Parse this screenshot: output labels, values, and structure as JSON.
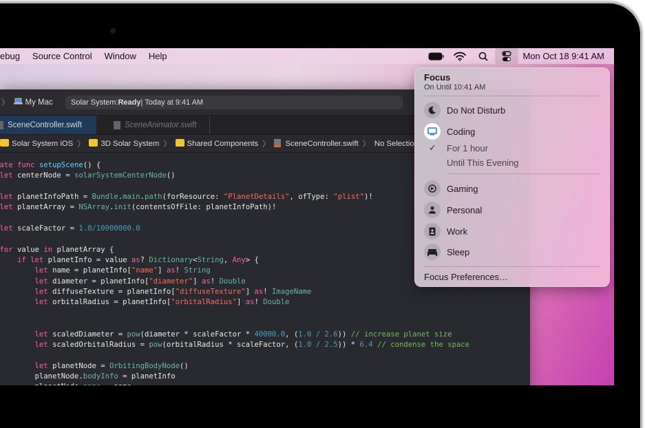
{
  "menubar": {
    "menus": [
      "ebug",
      "Source Control",
      "Window",
      "Help"
    ],
    "clock": "Mon Oct 18  9:41 AM",
    "status_icons": [
      "battery-icon",
      "wifi-icon",
      "search-icon",
      "control-center-icon"
    ]
  },
  "xcode": {
    "scheme": {
      "target": "My Mac"
    },
    "activity": {
      "project": "Solar System: ",
      "state": "Ready",
      "time": " | Today at 9:41 AM"
    },
    "tabs": [
      {
        "label": "SceneController.swift",
        "active": true
      },
      {
        "label": "SceneAnimator.swift",
        "active": false
      }
    ],
    "jumpbar": [
      "Solar System iOS",
      "3D Solar System",
      "Shared Components",
      "SceneController.swift",
      "No Selection"
    ],
    "code": [
      [
        [
          "private ",
          "kw"
        ],
        [
          "func ",
          "kw"
        ],
        [
          "setupScene",
          "ty"
        ],
        [
          "() {",
          "pl"
        ]
      ],
      [
        [
          "    let ",
          "kw"
        ],
        [
          "centerNode = ",
          "pl"
        ],
        [
          "solarSystemCenterNode",
          "fn"
        ],
        [
          "()",
          "pl"
        ]
      ],
      [],
      [
        [
          "    let ",
          "kw"
        ],
        [
          "planetInfoPath = ",
          "pl"
        ],
        [
          "Bundle",
          "fn"
        ],
        [
          ".",
          "pl"
        ],
        [
          "main",
          "fn"
        ],
        [
          ".",
          "pl"
        ],
        [
          "path",
          "fn"
        ],
        [
          "(forResource: ",
          "pl"
        ],
        [
          "\"PlanetDetails\"",
          "str"
        ],
        [
          ", ofType: ",
          "pl"
        ],
        [
          "\"plist\"",
          "str"
        ],
        [
          ")!",
          "pl"
        ]
      ],
      [
        [
          "    let ",
          "kw"
        ],
        [
          "planetArray = ",
          "pl"
        ],
        [
          "NSArray",
          "fn"
        ],
        [
          ".",
          "pl"
        ],
        [
          "init",
          "fn"
        ],
        [
          "(contentsOfFile: planetInfoPath)!",
          "pl"
        ]
      ],
      [],
      [
        [
          "    let ",
          "kw"
        ],
        [
          "scaleFactor = ",
          "pl"
        ],
        [
          "1.0/10000000.0",
          "num"
        ]
      ],
      [],
      [
        [
          "    for ",
          "kw"
        ],
        [
          "value ",
          "pl"
        ],
        [
          "in ",
          "kw"
        ],
        [
          "planetArray {",
          "pl"
        ]
      ],
      [
        [
          "        if let ",
          "kw"
        ],
        [
          "planetInfo = value ",
          "pl"
        ],
        [
          "as",
          "kw"
        ],
        [
          "? ",
          "pl"
        ],
        [
          "Dictionary",
          "fn"
        ],
        [
          "<",
          "pl"
        ],
        [
          "String",
          "fn"
        ],
        [
          ", ",
          "pl"
        ],
        [
          "Any",
          "kw"
        ],
        [
          "> {",
          "pl"
        ]
      ],
      [
        [
          "            let ",
          "kw"
        ],
        [
          "name = planetInfo[",
          "pl"
        ],
        [
          "\"name\"",
          "str"
        ],
        [
          "] ",
          "pl"
        ],
        [
          "as",
          "kw"
        ],
        [
          "! ",
          "pl"
        ],
        [
          "String",
          "fn"
        ]
      ],
      [
        [
          "            let ",
          "kw"
        ],
        [
          "diameter = planetInfo[",
          "pl"
        ],
        [
          "\"diameter\"",
          "str"
        ],
        [
          "] ",
          "pl"
        ],
        [
          "as",
          "kw"
        ],
        [
          "! ",
          "pl"
        ],
        [
          "Double",
          "fn"
        ]
      ],
      [
        [
          "            let ",
          "kw"
        ],
        [
          "diffuseTexture = planetInfo[",
          "pl"
        ],
        [
          "\"diffuseTexture\"",
          "str"
        ],
        [
          "] ",
          "pl"
        ],
        [
          "as",
          "kw"
        ],
        [
          "! ",
          "pl"
        ],
        [
          "ImageName",
          "fn"
        ]
      ],
      [
        [
          "            let ",
          "kw"
        ],
        [
          "orbitalRadius = planetInfo[",
          "pl"
        ],
        [
          "\"orbitalRadius\"",
          "str"
        ],
        [
          "] ",
          "pl"
        ],
        [
          "as",
          "kw"
        ],
        [
          "! ",
          "pl"
        ],
        [
          "Double",
          "fn"
        ]
      ],
      [],
      [],
      [
        [
          "            let ",
          "kw"
        ],
        [
          "scaledDiameter = ",
          "pl"
        ],
        [
          "pow",
          "fn"
        ],
        [
          "(diameter * scaleFactor * ",
          "pl"
        ],
        [
          "40000.0",
          "num"
        ],
        [
          ", (",
          "pl"
        ],
        [
          "1.0 / 2.6",
          "num"
        ],
        [
          ")) ",
          "pl"
        ],
        [
          "// increase planet size",
          "cm"
        ]
      ],
      [
        [
          "            let ",
          "kw"
        ],
        [
          "scaledOrbitalRadius = ",
          "pl"
        ],
        [
          "pow",
          "fn"
        ],
        [
          "(orbitalRadius * scaleFactor, (",
          "pl"
        ],
        [
          "1.0 / 2.5",
          "num"
        ],
        [
          ")) * ",
          "pl"
        ],
        [
          "6.4",
          "num"
        ],
        [
          " ",
          "pl"
        ],
        [
          "// condense the space",
          "cm"
        ]
      ],
      [],
      [
        [
          "            let ",
          "kw"
        ],
        [
          "planetNode = ",
          "pl"
        ],
        [
          "OrbitingBodyNode",
          "fn"
        ],
        [
          "()",
          "pl"
        ]
      ],
      [
        [
          "            planetNode.",
          "pl"
        ],
        [
          "bodyInfo",
          "fn"
        ],
        [
          " = planetInfo",
          "pl"
        ]
      ],
      [
        [
          "            planetNode.",
          "pl"
        ],
        [
          "name",
          "fn"
        ],
        [
          " = name",
          "pl"
        ]
      ]
    ]
  },
  "focus": {
    "title": "Focus",
    "subtitle": "On Until 10:41 AM",
    "modes": [
      {
        "label": "Do Not Disturb",
        "icon": "moon-icon"
      },
      {
        "label": "Coding",
        "icon": "display-icon",
        "active": true
      }
    ],
    "durations": [
      {
        "label": "For 1 hour",
        "checked": true
      },
      {
        "label": "Until This Evening"
      }
    ],
    "more_modes": [
      {
        "label": "Gaming",
        "icon": "gamecontroller-icon"
      },
      {
        "label": "Personal",
        "icon": "person-icon"
      },
      {
        "label": "Work",
        "icon": "badge-icon"
      },
      {
        "label": "Sleep",
        "icon": "bed-icon"
      }
    ],
    "preferences": "Focus Preferences…",
    "accent": "#1e7cf2"
  }
}
